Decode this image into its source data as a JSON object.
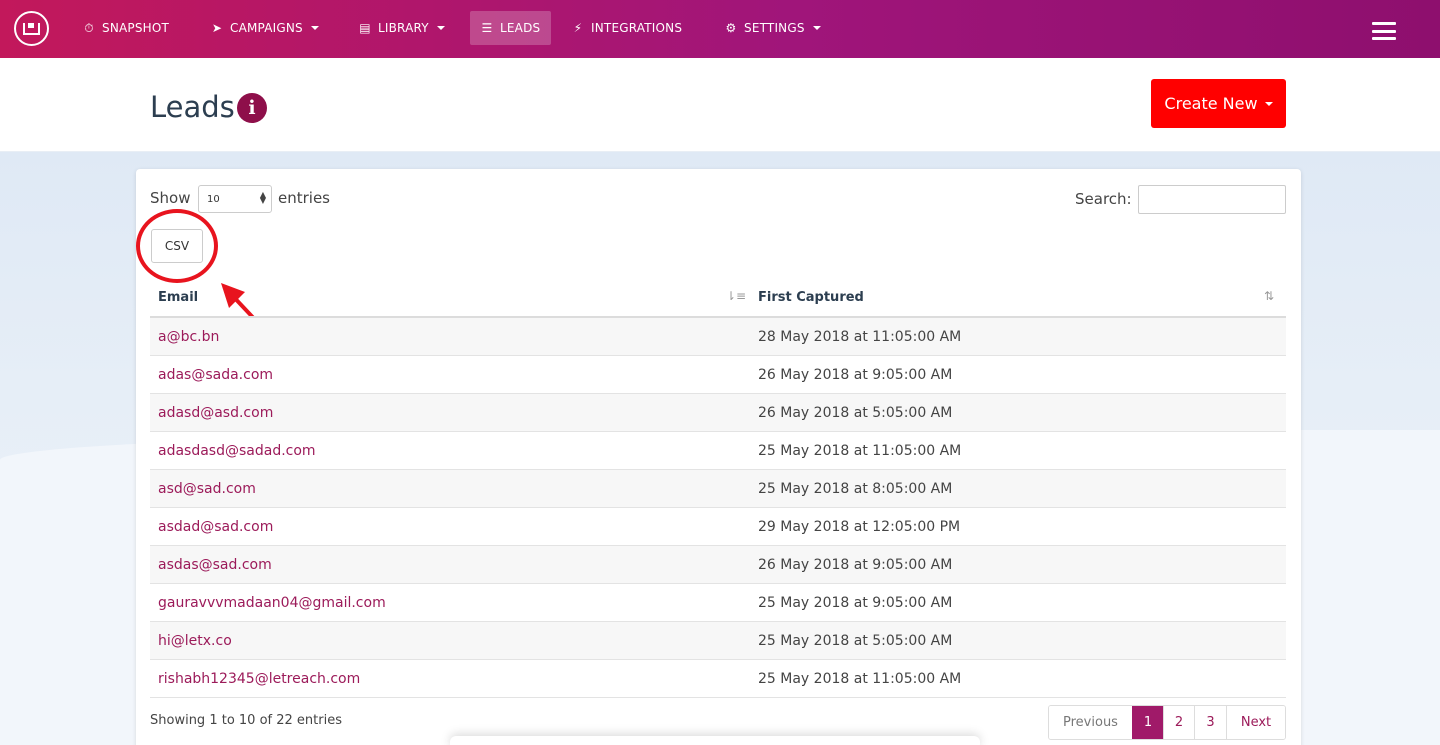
{
  "nav": {
    "items": [
      {
        "label": "SNAPSHOT",
        "icon": "dashboard-icon",
        "glyph": "⏱"
      },
      {
        "label": "CAMPAIGNS",
        "icon": "paper-plane-icon",
        "glyph": "➤"
      },
      {
        "label": "LIBRARY",
        "icon": "library-icon",
        "glyph": "▤"
      },
      {
        "label": "LEADS",
        "icon": "list-icon",
        "glyph": "☰"
      },
      {
        "label": "INTEGRATIONS",
        "icon": "plug-icon",
        "glyph": "⚡"
      },
      {
        "label": "SETTINGS",
        "icon": "gears-icon",
        "glyph": "⚙"
      }
    ],
    "active": "LEADS"
  },
  "header": {
    "title": "Leads",
    "create_label": "Create New"
  },
  "table_controls": {
    "show_label": "Show",
    "length_value": "10",
    "entries_label": "entries",
    "search_label": "Search:",
    "search_value": "",
    "csv_label": "CSV"
  },
  "table": {
    "columns": [
      "Email",
      "First Captured"
    ],
    "rows": [
      {
        "email": "a@bc.bn",
        "first_captured": "28 May 2018 at 11:05:00 AM"
      },
      {
        "email": "adas@sada.com",
        "first_captured": "26 May 2018 at 9:05:00 AM"
      },
      {
        "email": "adasd@asd.com",
        "first_captured": "26 May 2018 at 5:05:00 AM"
      },
      {
        "email": "adasdasd@sadad.com",
        "first_captured": "25 May 2018 at 11:05:00 AM"
      },
      {
        "email": "asd@sad.com",
        "first_captured": "25 May 2018 at 8:05:00 AM"
      },
      {
        "email": "asdad@sad.com",
        "first_captured": "29 May 2018 at 12:05:00 PM"
      },
      {
        "email": "asdas@sad.com",
        "first_captured": "26 May 2018 at 9:05:00 AM"
      },
      {
        "email": "gauravvvmadaan04@gmail.com",
        "first_captured": "25 May 2018 at 9:05:00 AM"
      },
      {
        "email": "hi@letx.co",
        "first_captured": "25 May 2018 at 5:05:00 AM"
      },
      {
        "email": "rishabh12345@letreach.com",
        "first_captured": "25 May 2018 at 11:05:00 AM"
      }
    ]
  },
  "footer": {
    "info": "Showing 1 to 10 of 22 entries",
    "pagination": [
      "Previous",
      "1",
      "2",
      "3",
      "Next"
    ],
    "current_page": "1"
  },
  "colors": {
    "nav_start": "#c2185b",
    "nav_end": "#8e0f6e",
    "accent": "#a01a69",
    "link": "#9c1b5a",
    "create_button": "#ff0000",
    "annotation": "#e8141e"
  }
}
